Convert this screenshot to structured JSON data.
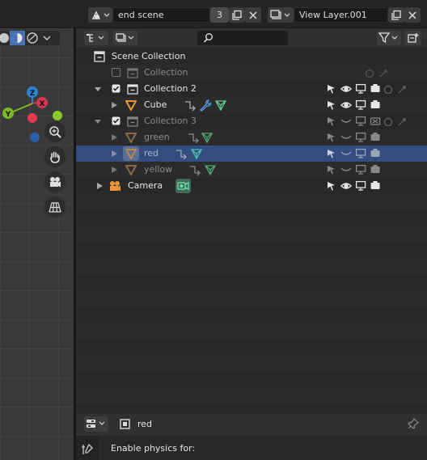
{
  "topbar": {
    "scene_name": "end scene",
    "scene_users": "3",
    "view_layer": "View Layer.001"
  },
  "outliner": {
    "search_placeholder": "",
    "rows": [
      {
        "label": "Scene Collection",
        "kind": "scene-collection"
      },
      {
        "label": "Collection",
        "kind": "collection",
        "excluded": true
      },
      {
        "label": "Collection 2",
        "kind": "collection"
      },
      {
        "label": "Cube",
        "kind": "mesh-object"
      },
      {
        "label": "Collection 3",
        "kind": "collection",
        "hidden": true
      },
      {
        "label": "green",
        "kind": "mesh-object",
        "hidden": true
      },
      {
        "label": "red",
        "kind": "mesh-object",
        "hidden": true,
        "selected": true
      },
      {
        "label": "yellow",
        "kind": "mesh-object",
        "hidden": true
      },
      {
        "label": "Camera",
        "kind": "camera-object"
      }
    ]
  },
  "properties": {
    "object_name": "red",
    "physics_label": "Enable physics for:"
  },
  "colors": {
    "selection": "#334d80",
    "object_orange": "#e8963a",
    "mesh_green": "#5fd18f",
    "axis_x": "#d23a4f",
    "axis_y": "#7fb62a",
    "axis_z": "#2f83d6"
  }
}
